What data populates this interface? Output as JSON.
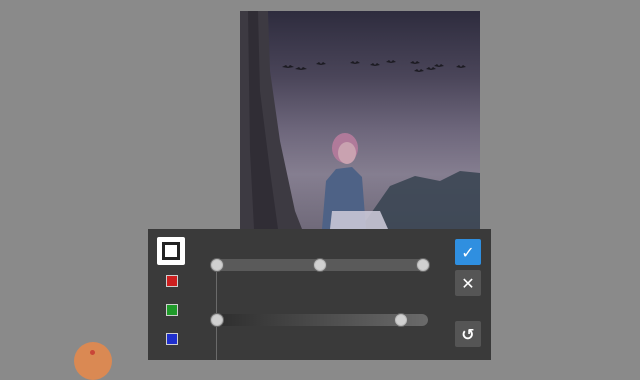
{
  "editor": {
    "photo": {
      "icon": "edited-photo",
      "description_icon": "image"
    },
    "panel": {
      "mode_button": {
        "icon": "square-frame-icon"
      },
      "channels": [
        {
          "name": "red-channel",
          "color": "#cc1f1f"
        },
        {
          "name": "green-channel",
          "color": "#1f9a2a"
        },
        {
          "name": "blue-channel",
          "color": "#1f2fcc"
        }
      ],
      "slider_top": {
        "stops": [
          0,
          0.5,
          1
        ]
      },
      "slider_bottom": {
        "stops": [
          0,
          0.87
        ]
      },
      "accept_color": "#2f8fe0",
      "actions": {
        "accept_icon": "check-icon",
        "cancel_icon": "close-icon",
        "reset_icon": "undo-icon"
      }
    },
    "floating_button": {
      "icon": "floating-action-icon",
      "color": "#e8894a"
    }
  }
}
